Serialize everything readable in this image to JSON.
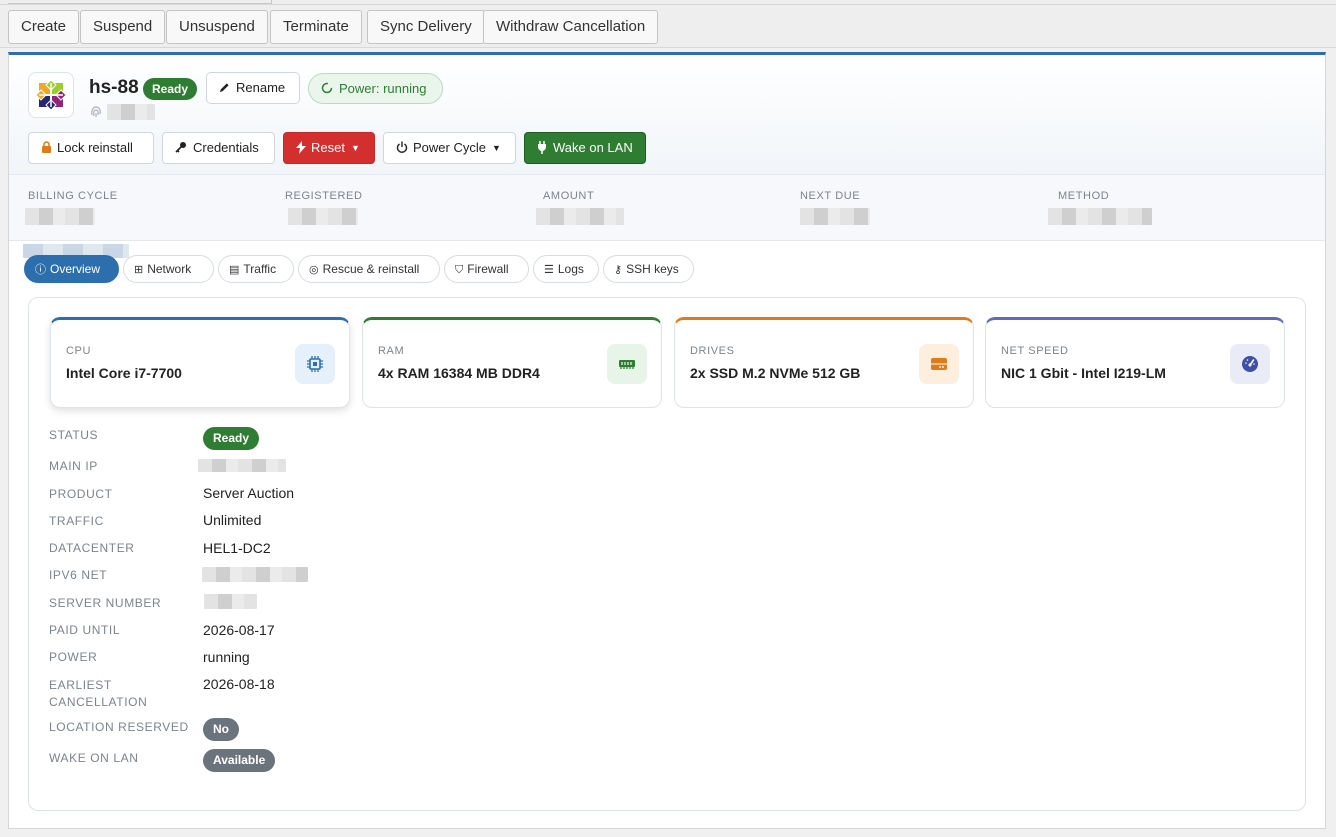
{
  "toolbar": {
    "buttons": [
      "Create",
      "Suspend",
      "Unsuspend",
      "Terminate",
      "Sync Delivery",
      "Withdraw Cancellation"
    ]
  },
  "server": {
    "hostname": "hs-88",
    "status_badge": "Ready",
    "rename_label": "Rename",
    "power_label": "Power: running"
  },
  "actions": {
    "lock_reinstall": "Lock reinstall",
    "credentials": "Credentials",
    "reset": "Reset",
    "power_cycle": "Power Cycle",
    "wake_on_lan": "Wake on LAN"
  },
  "billing": {
    "labels": [
      "BILLING CYCLE",
      "REGISTERED",
      "AMOUNT",
      "NEXT DUE",
      "METHOD"
    ]
  },
  "tabs": [
    "Overview",
    "Network",
    "Traffic",
    "Rescue & reinstall",
    "Firewall",
    "Logs",
    "SSH keys"
  ],
  "specs": [
    {
      "label": "CPU",
      "value": "Intel Core i7-7700",
      "icon": "cpu-icon",
      "color": "#2d6fad"
    },
    {
      "label": "RAM",
      "value": "4x RAM 16384 MB DDR4",
      "icon": "memory-icon",
      "color": "#2e7d32"
    },
    {
      "label": "DRIVES",
      "value": "2x SSD M.2 NVMe 512 GB",
      "icon": "drive-icon",
      "color": "#e07b1a"
    },
    {
      "label": "NET SPEED",
      "value": "NIC 1 Gbit - Intel I219-LM",
      "icon": "speedometer-icon",
      "color": "#5c6bc0"
    }
  ],
  "details": {
    "status_label": "STATUS",
    "status_value": "Ready",
    "main_ip_label": "MAIN IP",
    "product_label": "PRODUCT",
    "product_value": "Server Auction",
    "traffic_label": "TRAFFIC",
    "traffic_value": "Unlimited",
    "datacenter_label": "DATACENTER",
    "datacenter_value": "HEL1-DC2",
    "ipv6_label": "IPV6 NET",
    "server_number_label": "SERVER NUMBER",
    "paid_until_label": "PAID UNTIL",
    "paid_until_value": "2026-08-17",
    "power_label": "POWER",
    "power_value": "running",
    "earliest_cancellation_label_1": "EARLIEST",
    "earliest_cancellation_label_2": "CANCELLATION",
    "earliest_cancellation_value": "2026-08-18",
    "location_reserved_label": "LOCATION RESERVED",
    "location_reserved_value": "No",
    "wake_on_lan_label": "WAKE ON LAN",
    "wake_on_lan_value": "Available"
  }
}
